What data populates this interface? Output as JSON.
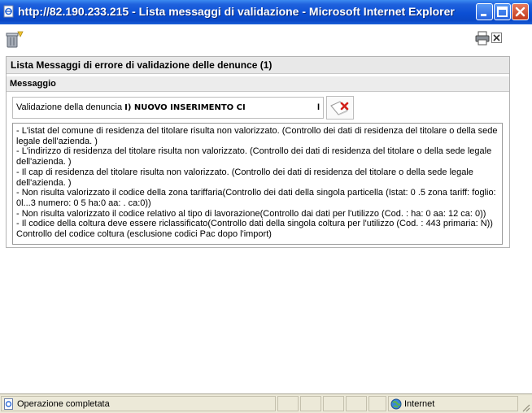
{
  "window": {
    "title": "http://82.190.233.215 - Lista messaggi di validazione - Microsoft Internet Explorer"
  },
  "panel": {
    "title": "Lista Messaggi di errore di validazione delle denunce (1)",
    "column_header": "Messaggio",
    "message_prefix": "Validazione della denuncia ",
    "message_value": "I) NUOVO INSERIMENTO CI",
    "message_suffix": "I",
    "details": [
      "- L'istat del comune di residenza del titolare risulta non valorizzato. (Controllo dei dati di residenza del titolare o della sede legale dell'azienda. )",
      "- L'indirizzo di residenza del titolare risulta non valorizzato. (Controllo dei dati di residenza del titolare o della sede legale dell'azienda. )",
      "- Il cap di residenza del titolare risulta non valorizzato. (Controllo dei dati di residenza del titolare o della sede legale dell'azienda. )",
      "- Non risulta valorizzato il codice della zona tariffaria(Controllo dei dati della singola particella (Istat: 0       .5 zona tariff: foglio: 0l...3 numero: 0      5 ha:0 aa:   . ca:0))",
      "- Non risulta valorizzato il codice relativo al tipo di lavorazione(Controllo dai dati per l'utilizzo (Cod. : ha: 0 aa: 12 ca: 0))",
      "- Il codice della coltura deve essere riclassificato(Controllo dati della singola coltura per l'utilizzo (Cod. : 443 primaria: N)) Controllo del codice coltura (esclusione codici Pac dopo l'import)"
    ]
  },
  "status": {
    "left_text": "Operazione completata",
    "zone_text": "Internet"
  },
  "colors": {
    "titlebar": "#0b4fd4",
    "panel_header": "#e8e8e8",
    "statusbar": "#ece9d8"
  }
}
